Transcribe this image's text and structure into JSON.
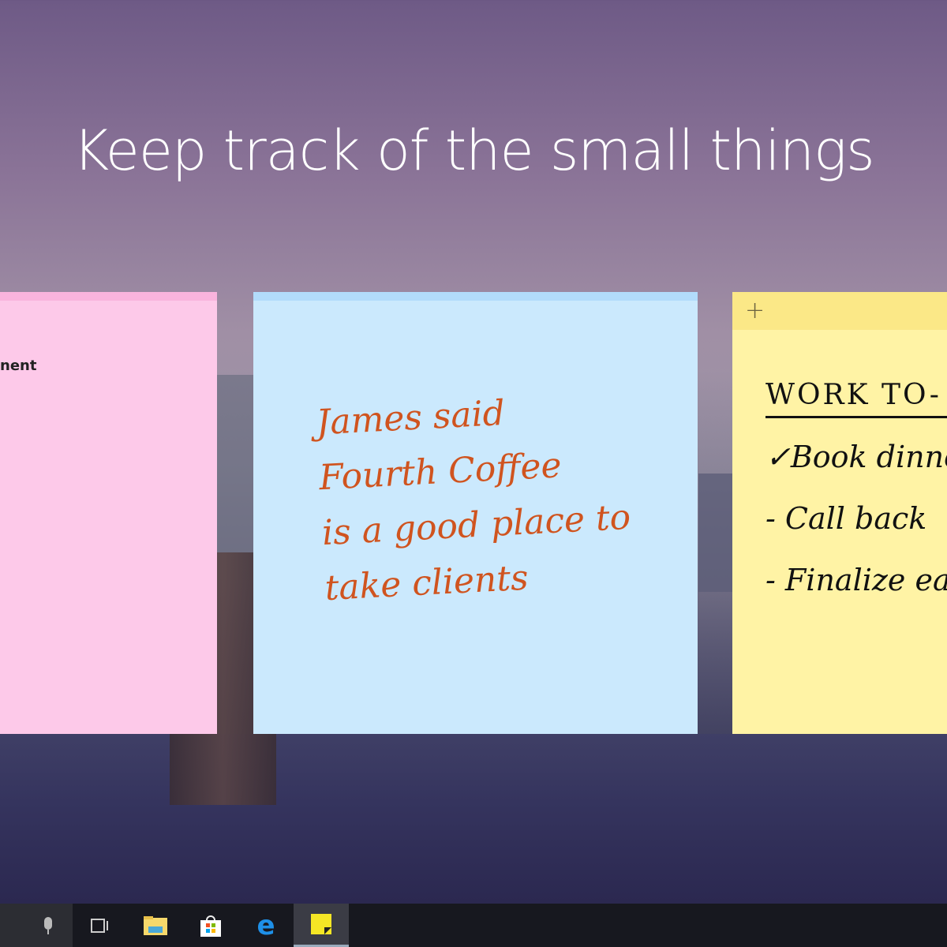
{
  "headline": "Keep track of the small things",
  "notes": {
    "pink": {
      "text": "nent",
      "color": "#fdc9e9"
    },
    "blue": {
      "lines": [
        "James said",
        "Fourth Coffee",
        "is a good place to",
        "take  clients"
      ],
      "color": "#cbe9fd"
    },
    "yellow": {
      "add_label": "+",
      "title": "WORK TO-",
      "items": [
        "✓Book dinne",
        "- Call back",
        "- Finalize ear"
      ],
      "color": "#fff3a5"
    }
  },
  "taskbar": {
    "icons": [
      "microphone-icon",
      "task-view-icon",
      "file-explorer-icon",
      "store-icon",
      "edge-icon",
      "sticky-notes-icon"
    ]
  }
}
